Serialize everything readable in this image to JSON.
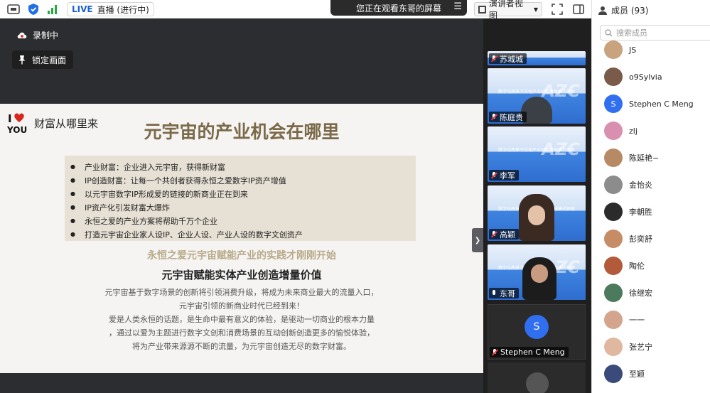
{
  "topbar": {
    "live_label": "LIVE",
    "live_status": "直播 (进行中)",
    "share_notice": "您正在观看东哥的屏幕",
    "view_mode": "演讲者视图"
  },
  "share": {
    "recording_label": "录制中",
    "lock_label": "锁定画面"
  },
  "slide": {
    "logo_top": "I",
    "logo_bottom": "YOU",
    "logo_text": "财富从哪里来",
    "title": "元宇宙的产业机会在哪里",
    "bullets": [
      "产业财富：企业进入元宇宙，获得新财富",
      "IP创造财富：让每一个共创者获得永恒之爱数字IP资产增值",
      "以元宇宙数字IP形成爱的链接的新商业正在到来",
      "IP资产化引发财富大爆炸",
      "永恒之爱的产业方案将帮助千万个企业",
      "打造元宇宙企业家人设IP、企业人设、产业人设的数字文创资产"
    ],
    "subtitle1": "永恒之爱元宇宙赋能产业的实践才刚刚开始",
    "subtitle2": "元宇宙赋能实体产业创造增量价值",
    "paragraph": [
      "元宇宙基于数字场景的创新将引领消费升级，将成为未来商业最大的流量入口，",
      "元宇宙引领的新商业时代已经到来！",
      "爱是人类永恒的话题，是生命中最有意义的体验，是驱动一切商业的根本力量",
      "，通过以爱为主题进行数字文创和消费场景的互动创新创造更多的愉悦体验，",
      "将为产业带来源源不断的流量，为元宇宙创造无尽的数字财富。"
    ]
  },
  "videos": {
    "thumb_slide_title": "数字化改革下文化产业创新发展模式探索",
    "thumb_big_text": "AZC",
    "tiles": [
      {
        "name": "苏城城"
      },
      {
        "name": "陈庭贵"
      },
      {
        "name": "李军"
      },
      {
        "name": "高颖"
      },
      {
        "name": "东哥"
      },
      {
        "name": "Stephen C Meng",
        "initial": "S"
      }
    ]
  },
  "members": {
    "title": "成员 (93)",
    "search_placeholder": "搜索成员",
    "list": [
      {
        "name": "JS",
        "color": "#c9a27e"
      },
      {
        "name": "o9Sylvia",
        "color": "#7a5a48"
      },
      {
        "name": "Stephen C Meng",
        "color": "#2f6ff0",
        "initial": "S"
      },
      {
        "name": "zlj",
        "color": "#d98fb0"
      },
      {
        "name": "陈延艳~",
        "color": "#b58a64"
      },
      {
        "name": "金怡炎",
        "color": "#8c8c8c"
      },
      {
        "name": "李朝胜",
        "color": "#2b2b2b"
      },
      {
        "name": "彭奕舒",
        "color": "#c58c66"
      },
      {
        "name": "陶伦",
        "color": "#b25a3a"
      },
      {
        "name": "徐继宏",
        "color": "#4c7a5c"
      },
      {
        "name": "一一",
        "color": "#d4a48c"
      },
      {
        "name": "张艺宁",
        "color": "#e0b8a0"
      },
      {
        "name": "至颖",
        "color": "#3a4a7a"
      }
    ]
  }
}
